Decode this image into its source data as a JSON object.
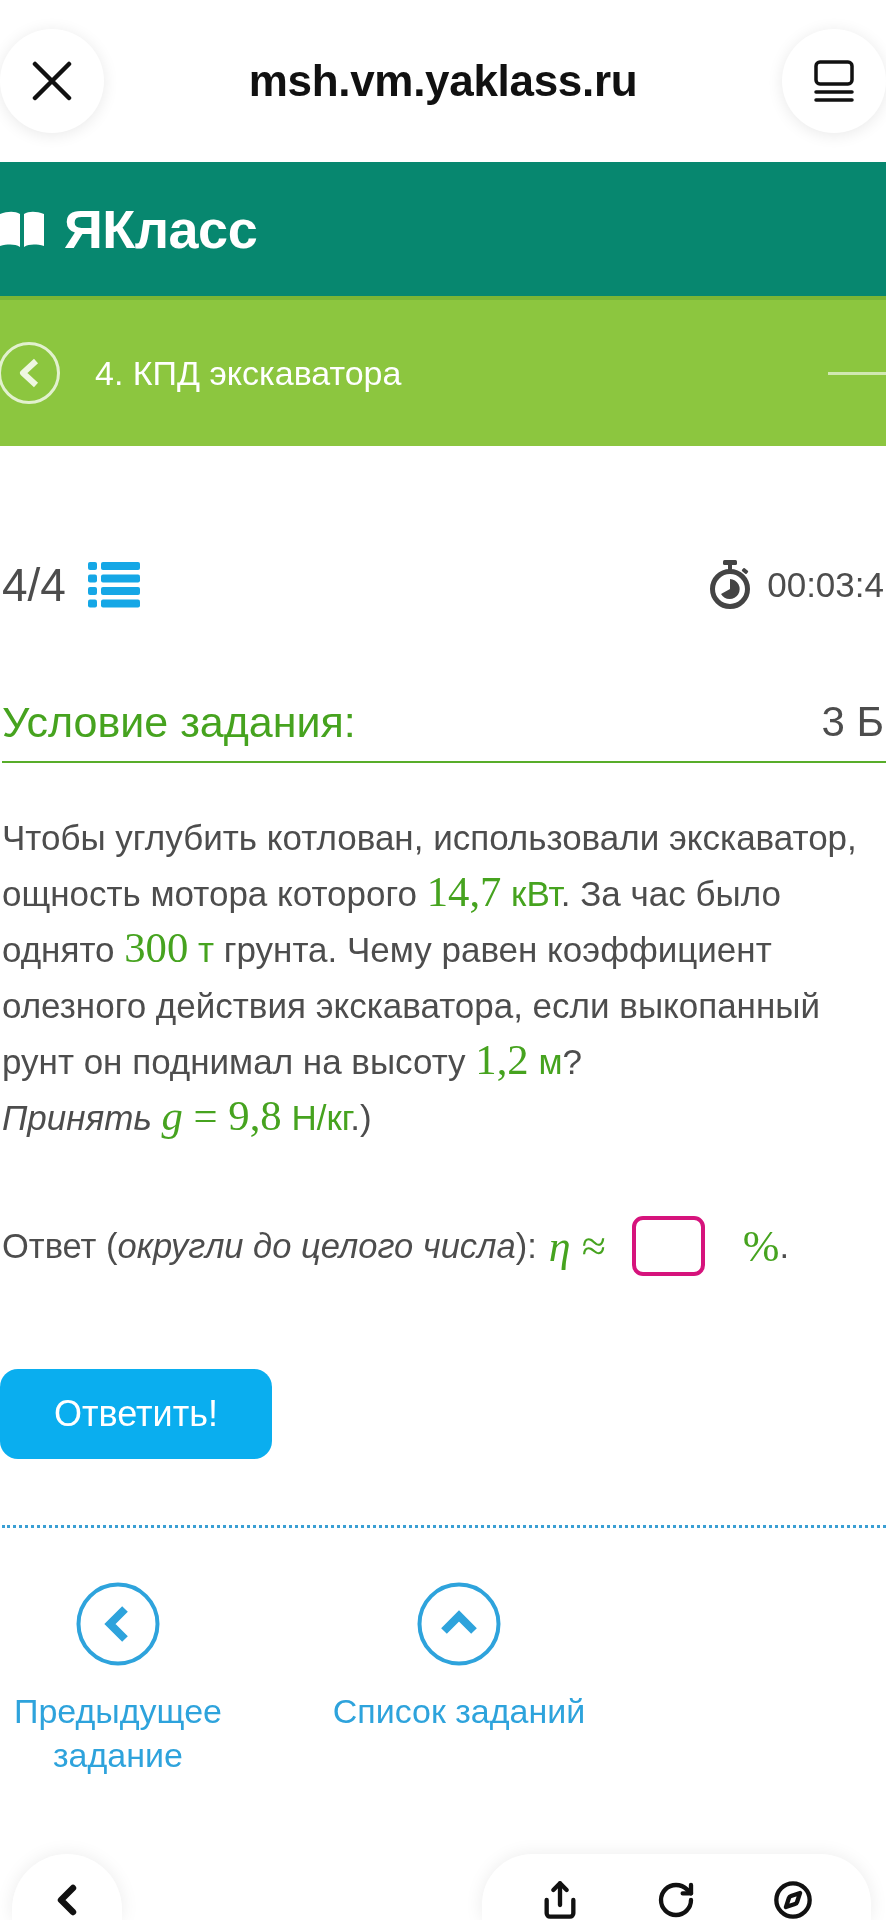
{
  "browser_bar": {
    "url": "msh.vm.yaklass.ru"
  },
  "site_header": {
    "logo": "ЯКласс"
  },
  "topic_bar": {
    "title": "4. КПД экскаватора"
  },
  "task_meta": {
    "counter": "4/4",
    "timer": "00:03:4"
  },
  "task": {
    "heading": "Условие задания:",
    "points": "3 Б",
    "lines": [
      [
        {
          "kind": "text",
          "text": "Чтобы углубить котлован, использовали экскаватор,"
        }
      ],
      [
        {
          "kind": "text",
          "text": "ощность мотора которого "
        },
        {
          "kind": "math",
          "text": "14,7"
        },
        {
          "kind": "unit",
          "text": " кВт"
        },
        {
          "kind": "text",
          "text": ". За час было"
        }
      ],
      [
        {
          "kind": "text",
          "text": "однято "
        },
        {
          "kind": "math",
          "text": "300"
        },
        {
          "kind": "unit",
          "text": " т"
        },
        {
          "kind": "text",
          "text": " грунта. Чему равен коэффициент"
        }
      ],
      [
        {
          "kind": "text",
          "text": "олезного действия экскаватора, если выкопанный"
        }
      ],
      [
        {
          "kind": "text",
          "text": "рунт он поднимал на высоту "
        },
        {
          "kind": "math",
          "text": "1,2"
        },
        {
          "kind": "unit",
          "text": " м"
        },
        {
          "kind": "text",
          "text": "?"
        }
      ],
      [
        {
          "kind": "italic",
          "text": "Принять "
        },
        {
          "kind": "math",
          "text": "*g* = 9,8"
        },
        {
          "kind": "unit",
          "text": " Н/кг"
        },
        {
          "kind": "text",
          "text": ".)"
        }
      ]
    ]
  },
  "answer": {
    "parts": [
      {
        "kind": "text",
        "text": "Ответ (*округли до целого числа*):"
      },
      {
        "kind": "math",
        "text": "*η* ≈"
      },
      {
        "kind": "field"
      },
      {
        "kind": "math",
        "text": "%"
      },
      {
        "kind": "text",
        "text": "."
      }
    ]
  },
  "submit_button": {
    "label": "Ответить!"
  },
  "task_nav": [
    {
      "kind": "previous",
      "label": "Предыдущее задание"
    },
    {
      "kind": "list",
      "label": "Список заданий"
    }
  ]
}
